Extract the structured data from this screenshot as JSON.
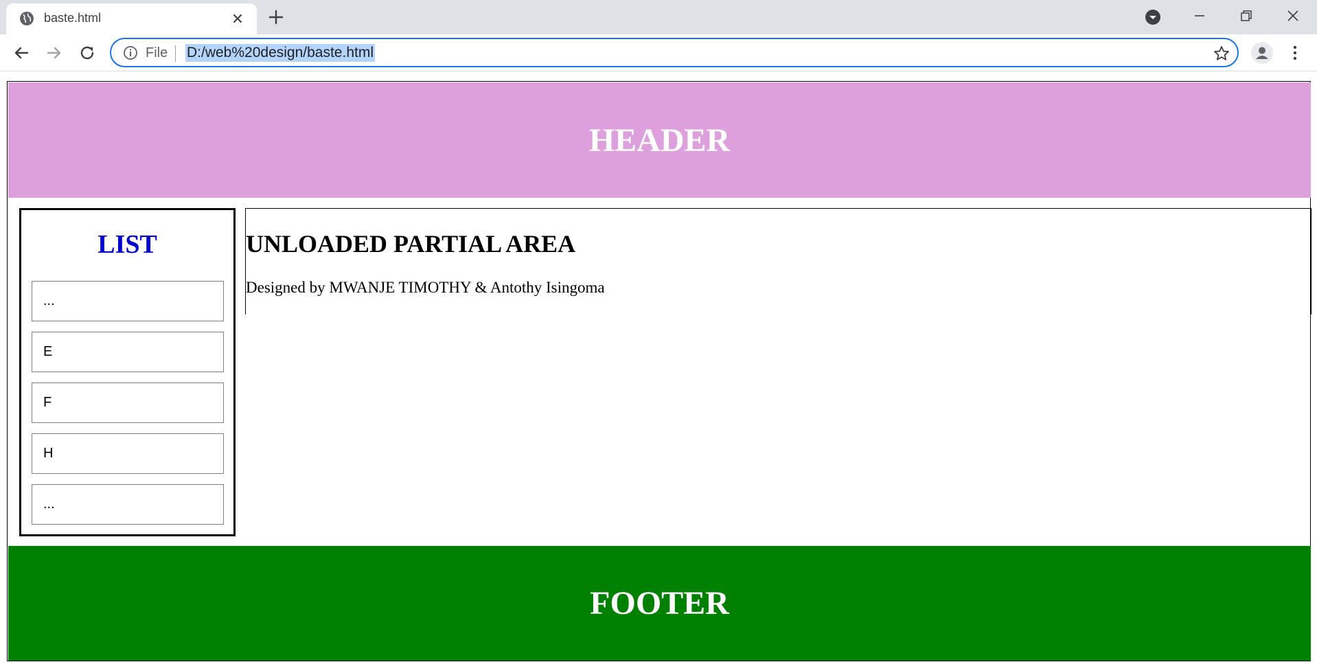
{
  "browser": {
    "tab_title": "baste.html",
    "scheme_label": "File",
    "url": "D:/web%20design/baste.html"
  },
  "page": {
    "header_title": "HEADER",
    "sidebar": {
      "title": "LIST",
      "items": [
        "...",
        "E",
        "F",
        "H",
        "..."
      ]
    },
    "content": {
      "title": "UNLOADED PARTIAL AREA",
      "credit": "Designed by MWANJE TIMOTHY & Antothy Isingoma"
    },
    "footer_title": "FOOTER"
  },
  "colors": {
    "header_bg": "#dda0dd",
    "footer_bg": "#008000",
    "list_title": "#0000cd",
    "omnibox_border": "#1a73e8",
    "url_highlight": "#b3d4fc"
  }
}
